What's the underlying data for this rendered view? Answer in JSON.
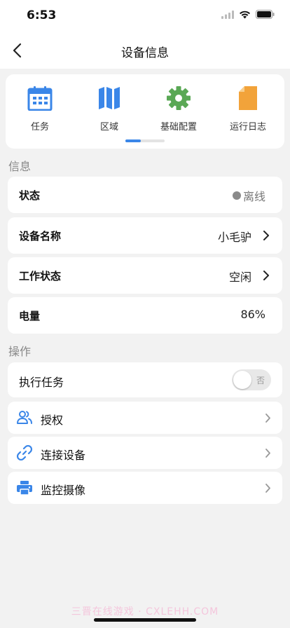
{
  "status_bar": {
    "time": "6:53"
  },
  "nav": {
    "title": "设备信息"
  },
  "quick_actions": [
    {
      "label": "任务",
      "icon": "calendar-icon",
      "color": "#3a86e8"
    },
    {
      "label": "区域",
      "icon": "map-icon",
      "color": "#3a86e8"
    },
    {
      "label": "基础配置",
      "icon": "gear-icon",
      "color": "#5aa855"
    },
    {
      "label": "运行日志",
      "icon": "document-icon",
      "color": "#f2a33a"
    }
  ],
  "sections": {
    "info": "信息",
    "operations": "操作"
  },
  "info": {
    "status": {
      "label": "状态",
      "value": "离线"
    },
    "device_name": {
      "label": "设备名称",
      "value": "小毛驴"
    },
    "work_status": {
      "label": "工作状态",
      "value": "空闲"
    },
    "battery": {
      "label": "电量",
      "value": "86%"
    }
  },
  "operations": {
    "execute_task": {
      "label": "执行任务",
      "toggle_text": "否",
      "enabled": false
    },
    "authorize": {
      "label": "授权",
      "icon": "users-icon"
    },
    "connect_device": {
      "label": "连接设备",
      "icon": "link-icon"
    },
    "camera": {
      "label": "监控摄像",
      "icon": "printer-icon"
    }
  },
  "colors": {
    "accent": "#3a86e8",
    "gear": "#5aa855",
    "doc": "#f2a33a"
  },
  "watermark": "三晋在线游戏 · CXLEHH.COM"
}
